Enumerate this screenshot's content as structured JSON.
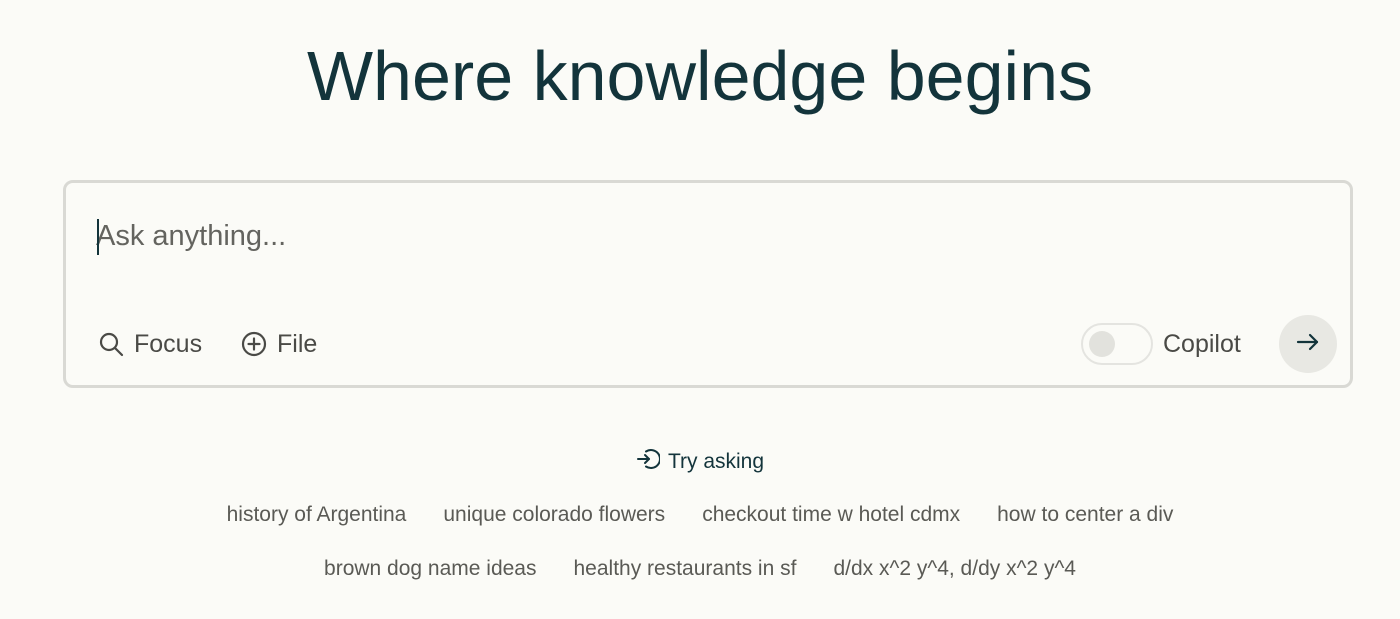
{
  "headline": "Where knowledge begins",
  "search": {
    "placeholder": "Ask anything...",
    "value": ""
  },
  "tools": {
    "focus_label": "Focus",
    "file_label": "File",
    "copilot_label": "Copilot",
    "copilot_enabled": false
  },
  "icons": {
    "focus": "search-icon",
    "file": "plus-circle-icon",
    "submit": "arrow-right-icon",
    "try_asking": "arrow-into-icon"
  },
  "try_asking": {
    "label": "Try asking"
  },
  "suggestions": {
    "row1": [
      "history of Argentina",
      "unique colorado flowers",
      "checkout time w hotel cdmx",
      "how to center a div"
    ],
    "row2": [
      "brown dog name ideas",
      "healthy restaurants in sf",
      "d/dx x^2 y^4, d/dy x^2 y^4"
    ]
  },
  "colors": {
    "background": "#fbfbf7",
    "text": "#13343b",
    "border": "#d9d9d4",
    "muted": "#5a5a55"
  }
}
